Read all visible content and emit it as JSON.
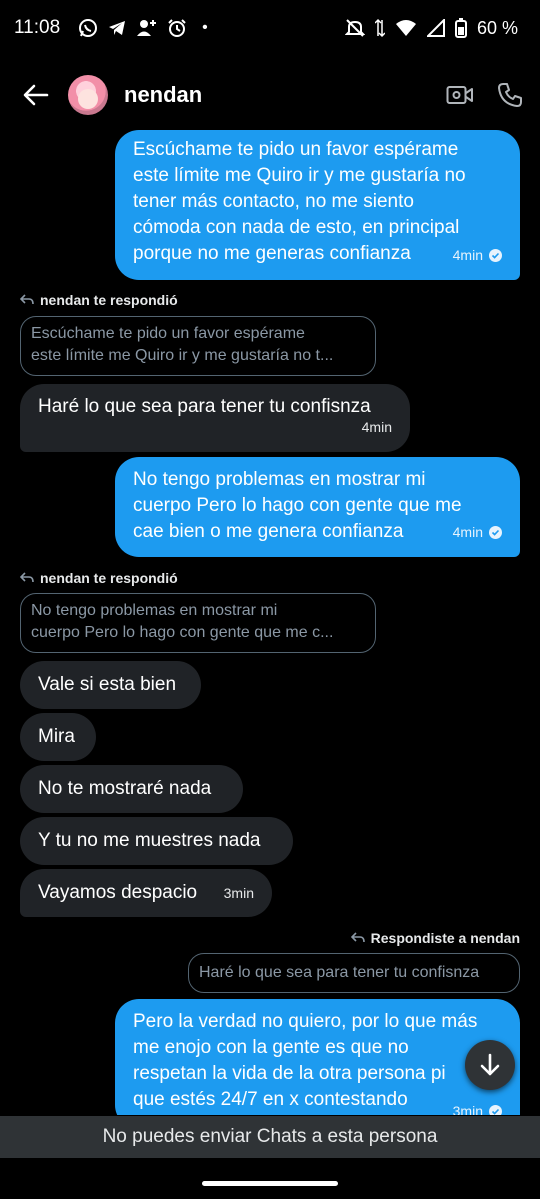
{
  "status": {
    "time": "11:08",
    "dot": "•",
    "battery": "60 %",
    "left_icons": [
      "whatsapp-icon",
      "telegram-icon",
      "add-person-icon",
      "alarm-icon"
    ],
    "right_icons": [
      "mute-icon",
      "data-arrows-icon",
      "wifi-icon",
      "signal-icon",
      "battery-icon"
    ]
  },
  "header": {
    "name": "nendan",
    "actions": [
      "video-call-icon",
      "phone-icon"
    ]
  },
  "messages": [
    {
      "type": "sent",
      "lines": [
        "Escúchame te pido un favor espérame",
        "este límite me Quiro ir y me gustaría no",
        "tener más contacto, no me siento",
        "cómoda con nada de esto, en principal",
        "porque no me generas confianza"
      ],
      "time": "4min"
    },
    {
      "type": "reply_label",
      "text": "nendan te respondió"
    },
    {
      "type": "quote",
      "lines": [
        "Escúchame te pido un favor espérame",
        "este límite me Quiro ir y me gustaría no t..."
      ]
    },
    {
      "type": "received",
      "lines": [
        "Haré lo que sea para tener tu confisnza"
      ],
      "time": "4min"
    },
    {
      "type": "sent",
      "lines": [
        "No tengo problemas en mostrar mi",
        "cuerpo Pero lo hago con gente que me",
        "cae bien o me genera confianza"
      ],
      "time": "4min"
    },
    {
      "type": "reply_label",
      "text": "nendan te respondió"
    },
    {
      "type": "quote",
      "lines": [
        "No tengo problemas en mostrar mi",
        "cuerpo Pero lo hago con gente que me c..."
      ]
    },
    {
      "type": "received",
      "lines": [
        "Vale si esta bien"
      ]
    },
    {
      "type": "received",
      "lines": [
        "Mira"
      ]
    },
    {
      "type": "received",
      "lines": [
        "No te mostraré nada"
      ]
    },
    {
      "type": "received",
      "lines": [
        "Y tu no me muestres nada"
      ]
    },
    {
      "type": "received",
      "lines": [
        "Vayamos despacio"
      ],
      "time": "3min"
    },
    {
      "type": "reply_label",
      "text": "Respondiste a nendan"
    },
    {
      "type": "quote",
      "lines": [
        "Haré lo que sea para tener tu confisnza"
      ]
    },
    {
      "type": "sent",
      "lines": [
        "Pero la verdad no quiero, por lo que más",
        "me enojo con la gente es que no",
        "respetan la vida de la otra persona pi",
        "que estés 24/7 en x contestando"
      ],
      "time": "3min"
    }
  ],
  "footer": {
    "notice": "No puedes enviar Chats a esta persona"
  },
  "colors": {
    "sent_bubble": "#1d9bf0",
    "received_bubble": "#202327",
    "background": "#000000"
  }
}
